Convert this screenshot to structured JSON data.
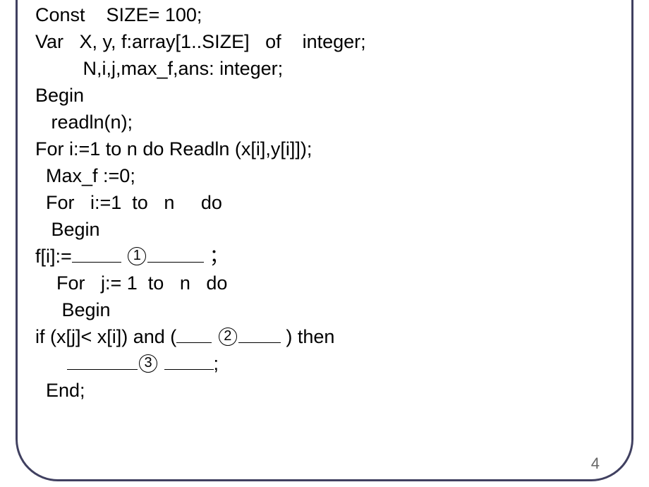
{
  "code": {
    "line1": "Const    SIZE= 100;",
    "line2": "Var   X, y, f:array[1..SIZE]   of    integer;",
    "line3": "         N,i,j,max_f,ans: integer;",
    "line4": "Begin",
    "line5": "   readln(n);",
    "line6_a": "  For  i:=1  to  n  do",
    "line6_b": "     Readln (x[i],y[i]]);",
    "line7": "  Max_f :=0;",
    "line8": "  For   i:=1  to   n     do",
    "line9": "   Begin",
    "line10_a": "    f[i]:=",
    "line10_b": " ；",
    "line11": "    For   j:= 1  to   n   do",
    "line12": "     Begin",
    "line13_a": "      if  (x[j]< x[i])  and  (",
    "line13_b": " )    then",
    "line14_a": "      ",
    "line14_b": ";",
    "line15": "  End;"
  },
  "blanks": {
    "num1": "1",
    "num2": "2",
    "num3": "3"
  },
  "page_number": "4"
}
